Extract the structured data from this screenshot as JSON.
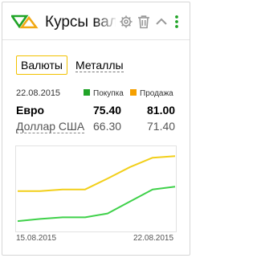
{
  "header": {
    "title": "Курсы валют",
    "icons": [
      "logo-icon",
      "gear-icon",
      "trash-icon",
      "chevron-up-icon",
      "more-icon"
    ],
    "colors": {
      "logo_green": "#21a428",
      "logo_orange": "#f1a915",
      "icon_gray": "#9a9a9a",
      "more_green": "#21a428"
    }
  },
  "tabs": [
    {
      "label": "Валюты",
      "active": true
    },
    {
      "label": "Металлы",
      "active": false
    }
  ],
  "rates": {
    "date": "22.08.2015",
    "buy_label": "Покупка",
    "sell_label": "Продажа",
    "buy_color": "#21a428",
    "sell_color": "#f5a000",
    "rows": [
      {
        "name": "Евро",
        "buy": "75.40",
        "sell": "81.00"
      },
      {
        "name": "Доллар США",
        "buy": "66.30",
        "sell": "71.40"
      }
    ]
  },
  "chart": {
    "start_date": "15.08.2015",
    "end_date": "22.08.2015"
  },
  "chart_data": {
    "type": "line",
    "x": [
      "15.08.2015",
      "16.08.2015",
      "17.08.2015",
      "18.08.2015",
      "19.08.2015",
      "20.08.2015",
      "21.08.2015",
      "22.08.2015"
    ],
    "series": [
      {
        "name": "Продажа",
        "color": "#f2cf1a",
        "values": [
          74.6,
          74.6,
          74.9,
          74.9,
          76.9,
          79.0,
          80.7,
          81.0
        ]
      },
      {
        "name": "Покупка",
        "color": "#3fd14a",
        "values": [
          69.1,
          69.5,
          69.8,
          69.8,
          70.5,
          72.7,
          74.9,
          75.4
        ]
      }
    ],
    "ylim": [
      67.5,
      82.5
    ],
    "grid": false
  }
}
